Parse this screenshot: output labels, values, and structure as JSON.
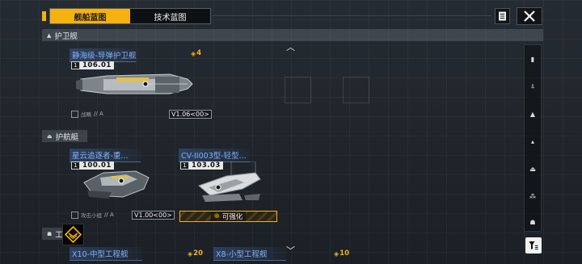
{
  "tabs": {
    "blueprints_ship": "舰船蓝图",
    "blueprints_tech": "技术蓝图"
  },
  "sections": {
    "frigate": "护卫舰",
    "escort": "护航艇",
    "engineering": "工"
  },
  "ships": [
    {
      "name": "静海级-导弹护卫舰",
      "id_prefix": "1",
      "id": "106.01",
      "version": "V1.06<00>",
      "footer": "战略",
      "slash": "// A",
      "cost": "4"
    },
    {
      "name": "星云追逐者-重...",
      "id_prefix": "1",
      "id": "100.01",
      "version": "V1.00<00>",
      "footer": "攻击小组",
      "slash": "// A"
    },
    {
      "name": "CV-II003型-轻型...",
      "id_prefix": "1",
      "id": "103.03",
      "upgrade": "可强化"
    },
    {
      "name": "X10-中型工程舰",
      "cost": "20"
    },
    {
      "name": "X8-小型工程舰",
      "cost": "10"
    }
  ],
  "icons": {
    "close": "close-icon",
    "document": "document-icon",
    "filter": "filter-icon",
    "collapse": "chevron-up-icon",
    "expand": "chevron-down-icon"
  },
  "colors": {
    "accent": "#f5b20e",
    "ship_name": "#7fb0ff",
    "background": "#1d2228"
  }
}
